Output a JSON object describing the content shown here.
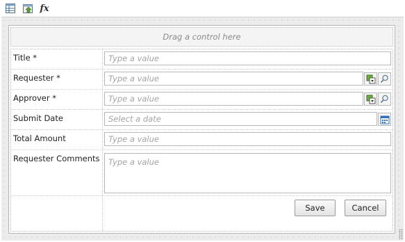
{
  "toolbar": {
    "items": [
      {
        "name": "table-layout-icon"
      },
      {
        "name": "insert-control-icon"
      },
      {
        "name": "formula-icon",
        "glyph": "fx"
      }
    ]
  },
  "form": {
    "drag_hint": "Drag a control here",
    "fields": {
      "title": {
        "label": "Title *",
        "placeholder": "Type a value"
      },
      "requester": {
        "label": "Requester *",
        "placeholder": "Type a value"
      },
      "approver": {
        "label": "Approver *",
        "placeholder": "Type a value"
      },
      "submit_date": {
        "label": "Submit Date",
        "placeholder": "Select a date"
      },
      "total_amount": {
        "label": "Total Amount",
        "placeholder": "Type a value"
      },
      "requester_comments": {
        "label": "Requester Comments",
        "placeholder": "Type a value"
      }
    },
    "buttons": {
      "save": "Save",
      "cancel": "Cancel"
    }
  },
  "colors": {
    "canvas_bg": "#ececec",
    "people_picker_green": "#4a8a2a",
    "calendar_blue": "#2f6fb5"
  }
}
